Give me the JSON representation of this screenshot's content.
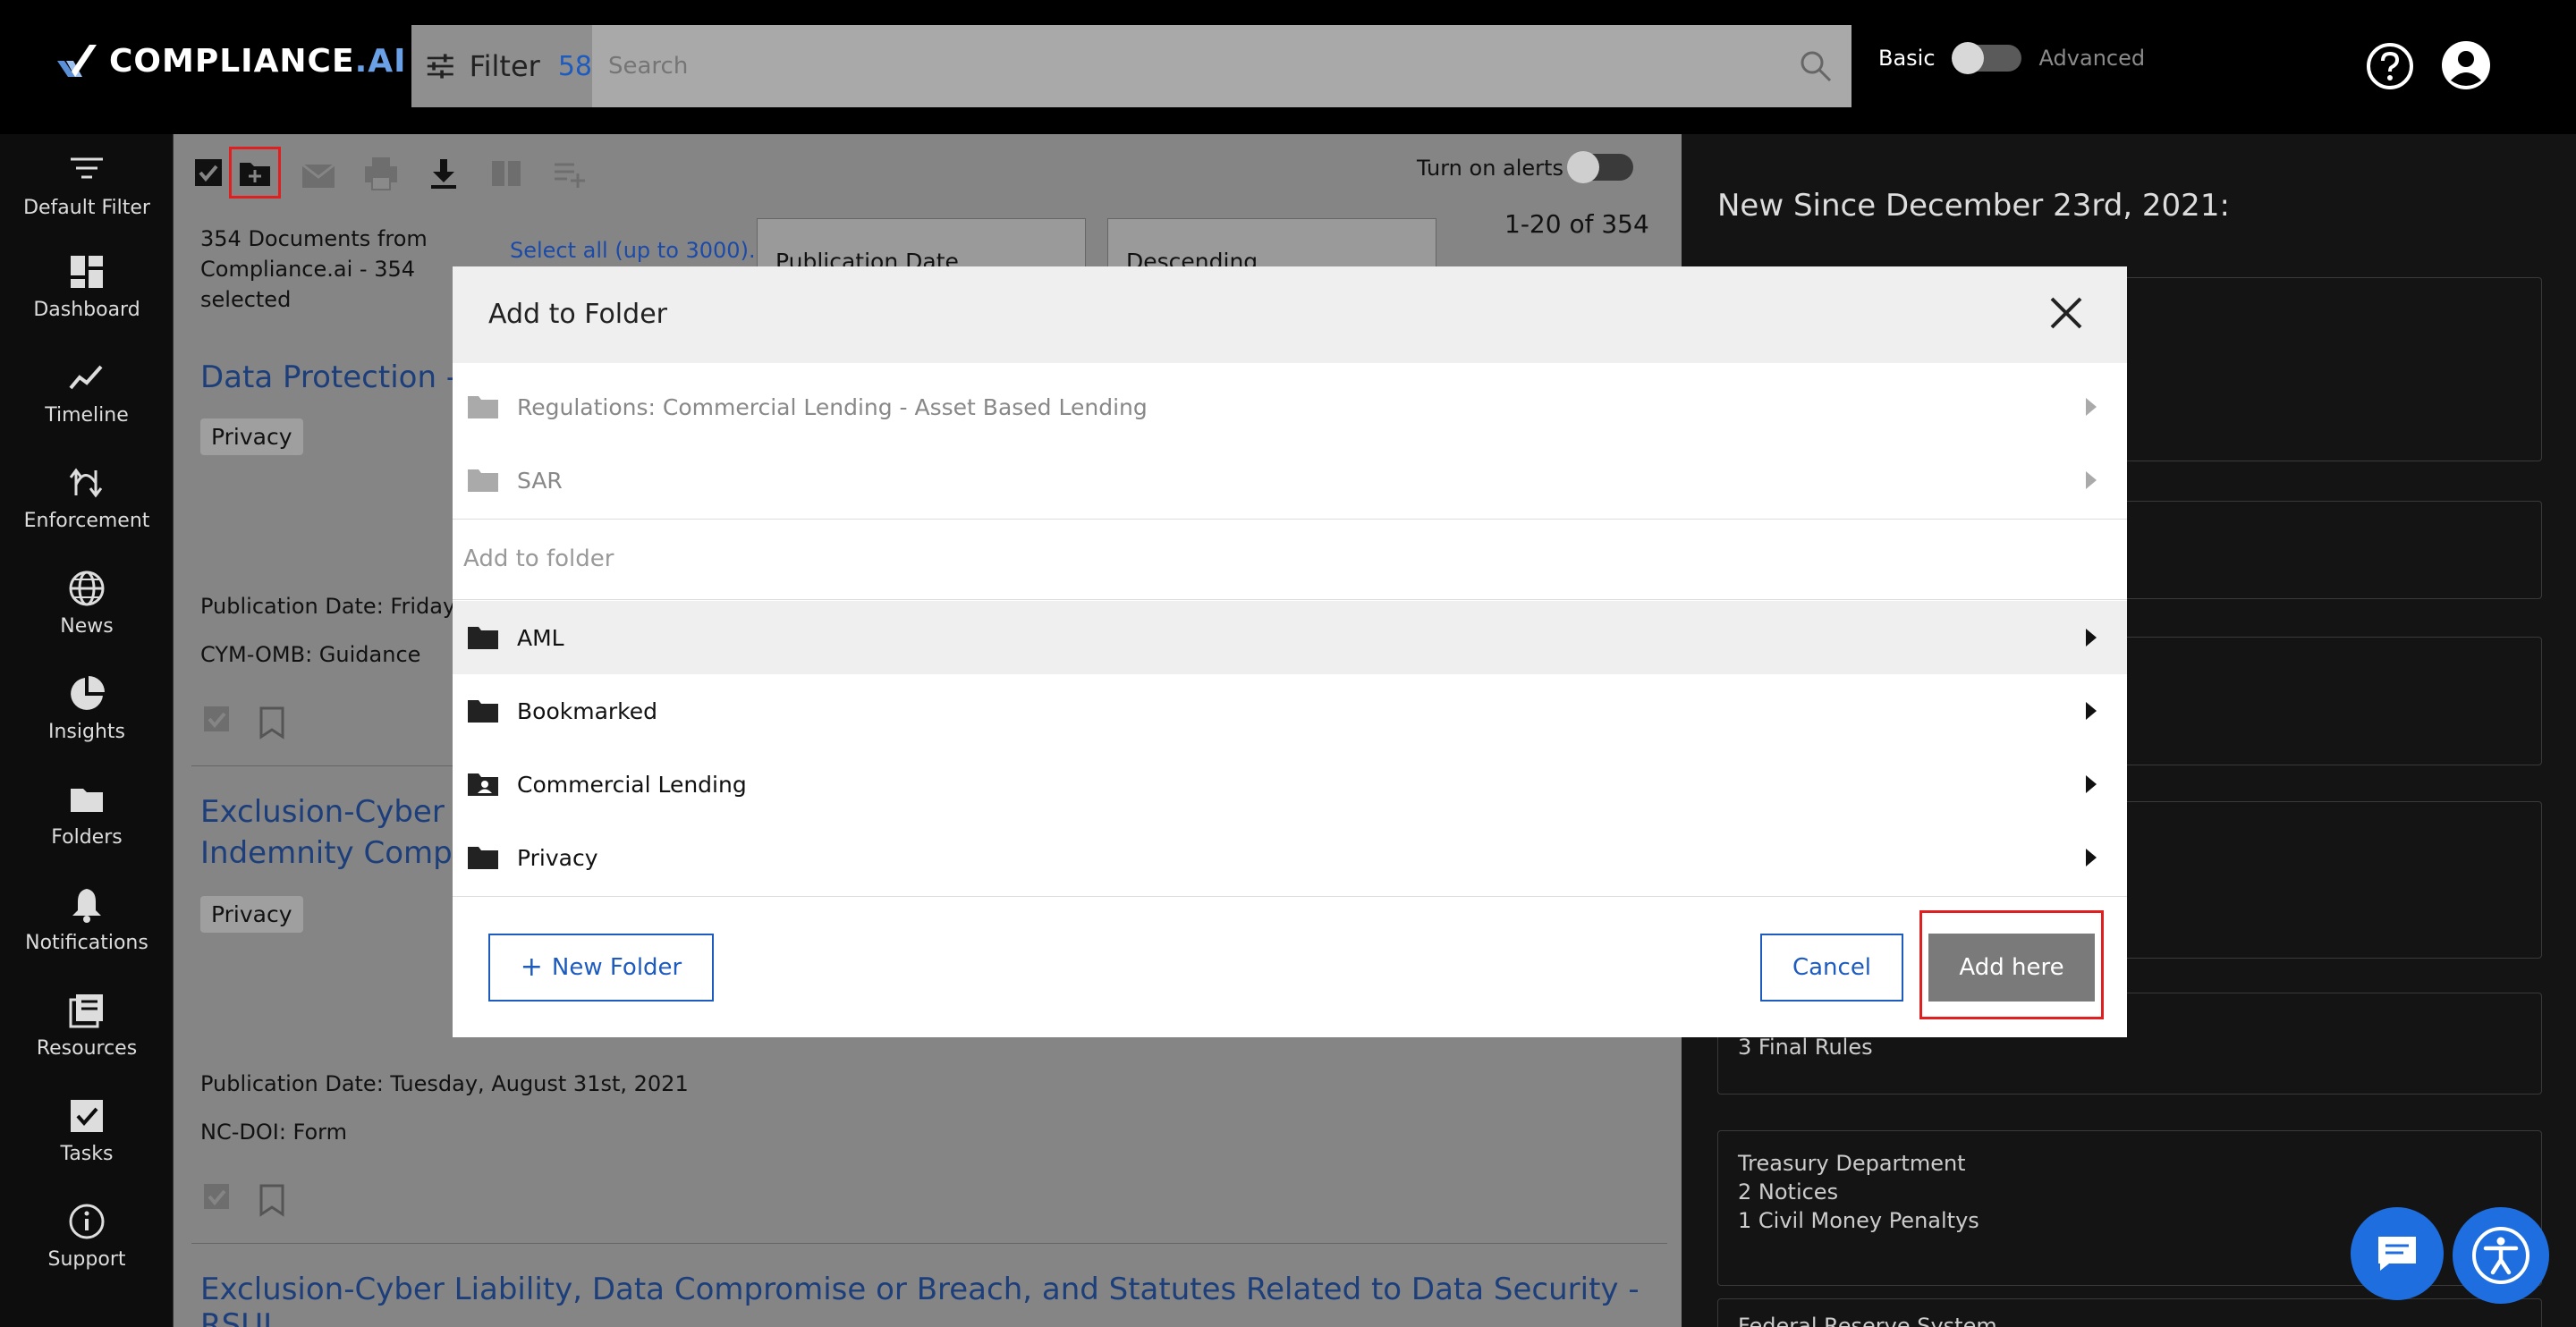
{
  "header": {
    "logo_main": "COMPLIANCE",
    "logo_ai": ".AI",
    "filter_label": "Filter",
    "filter_count": "58",
    "search_placeholder": "Search",
    "mode_basic": "Basic",
    "mode_advanced": "Advanced"
  },
  "sidenav": {
    "items": [
      {
        "label": "Default Filter",
        "icon": "filter-lines-icon"
      },
      {
        "label": "Dashboard",
        "icon": "dashboard-icon"
      },
      {
        "label": "Timeline",
        "icon": "timeline-icon"
      },
      {
        "label": "Enforcement",
        "icon": "enforcement-icon"
      },
      {
        "label": "News",
        "icon": "globe-icon"
      },
      {
        "label": "Insights",
        "icon": "pie-chart-icon"
      },
      {
        "label": "Folders",
        "icon": "folder-icon"
      },
      {
        "label": "Notifications",
        "icon": "bell-icon"
      },
      {
        "label": "Resources",
        "icon": "resources-icon"
      },
      {
        "label": "Tasks",
        "icon": "checkbox-icon"
      },
      {
        "label": "Support",
        "icon": "info-icon"
      }
    ]
  },
  "main": {
    "alerts_label": "Turn on alerts",
    "doc_count_line1": "354 Documents from",
    "doc_count_line2": "Compliance.ai - 354 selected",
    "select_all": "Select all (up to 3000).",
    "sort_field": "Publication Date",
    "sort_order": "Descending",
    "pager": "1-20 of 354",
    "docs": [
      {
        "title": "Data Protection - G",
        "tag": "Privacy",
        "pub_date": "Publication Date: Friday, S",
        "source": "CYM-OMB:  Guidance"
      },
      {
        "title_line1": "Exclusion-Cyber Lia",
        "title_line2": "Indemnity Compar",
        "tag": "Privacy",
        "pub_date": "Publication Date: Tuesday, August 31st, 2021",
        "source": "NC-DOI:  Form"
      },
      {
        "title_line1": "Exclusion-Cyber Liability, Data Compromise or Breach, and Statutes Related to Data Security - RSUI"
      }
    ]
  },
  "rightpanel": {
    "heading": "New Since December 23rd, 2021:",
    "card_final_rules": "3 Final Rules",
    "treasury_title": "Treasury Department",
    "treasury_notices": "2 Notices",
    "treasury_penalties": "1 Civil Money Penaltys",
    "frs_partial": "Federal Reserve System"
  },
  "modal": {
    "title": "Add to Folder",
    "parent_folders": [
      {
        "name": "Regulations: Commercial Lending - Asset Based Lending"
      },
      {
        "name": "SAR"
      }
    ],
    "section_label": "Add to folder",
    "folders": [
      {
        "name": "AML",
        "icon": "folder-icon"
      },
      {
        "name": "Bookmarked",
        "icon": "folder-icon"
      },
      {
        "name": "Commercial Lending",
        "icon": "shared-folder-icon"
      },
      {
        "name": "Privacy",
        "icon": "folder-icon"
      }
    ],
    "new_folder": "New Folder",
    "cancel": "Cancel",
    "add_here": "Add here"
  },
  "colors": {
    "accent": "#1e5bbf",
    "highlight": "#e02020",
    "fab": "#1e6ee0"
  }
}
